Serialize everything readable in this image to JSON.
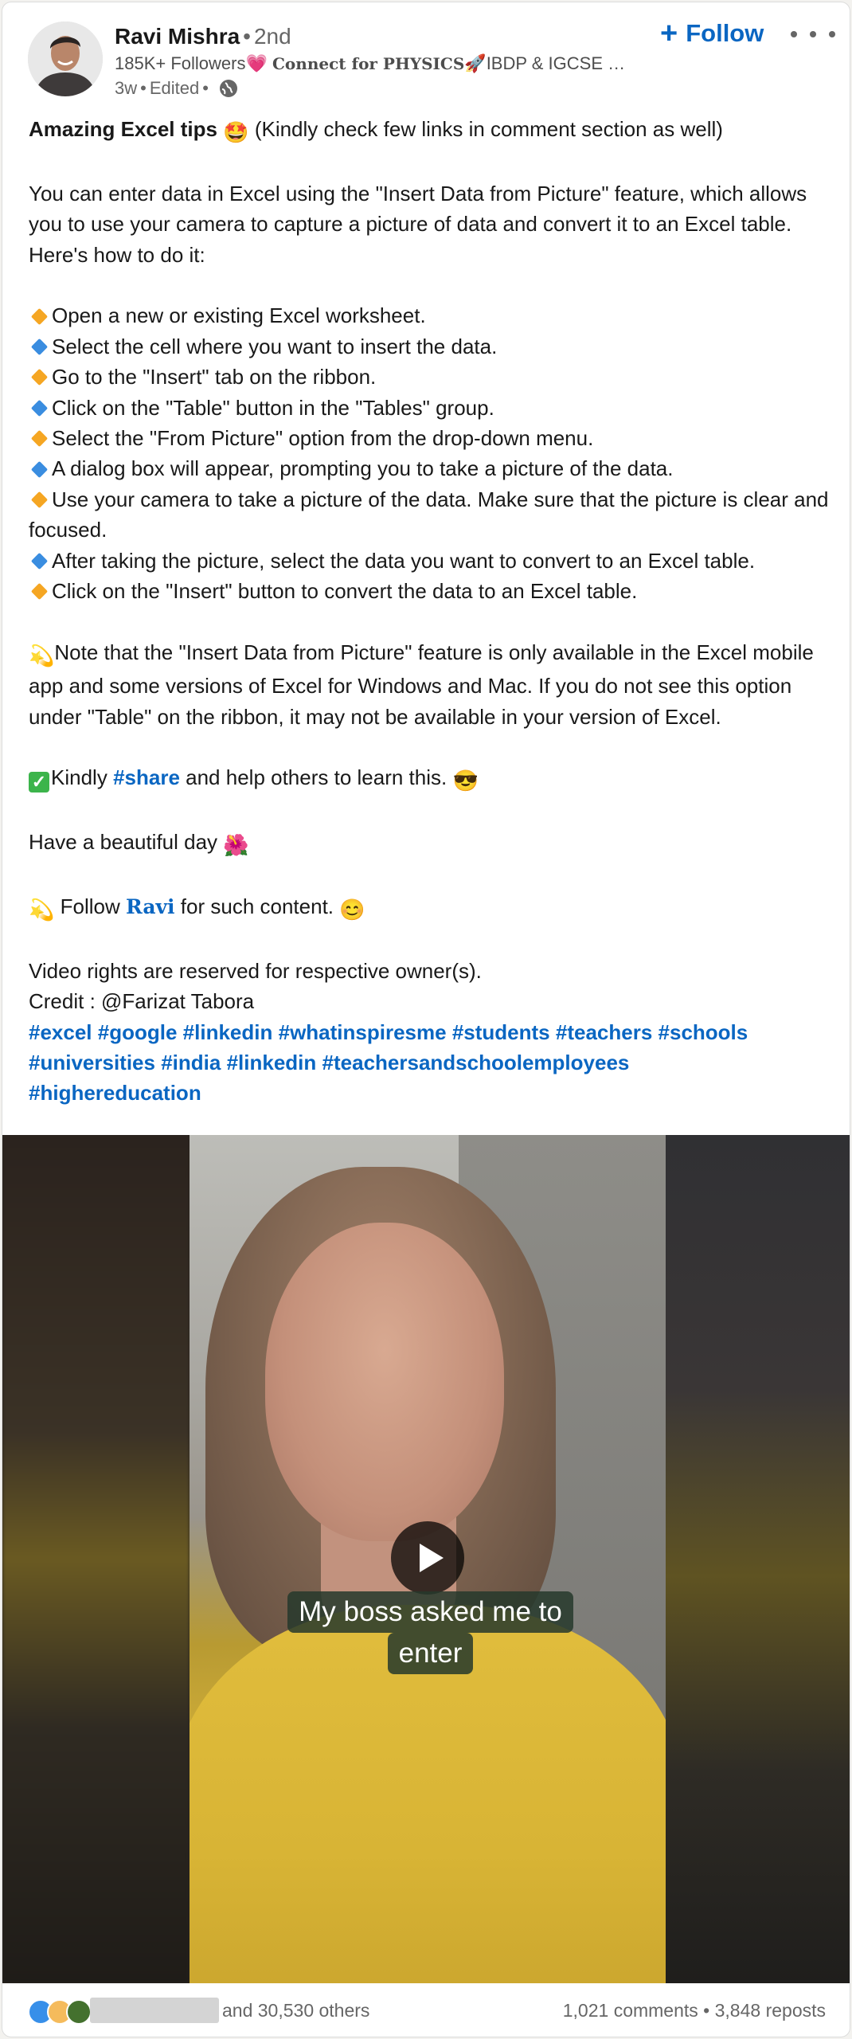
{
  "author": {
    "name": "Ravi Mishra",
    "degree": "2nd",
    "followers": "185K+ Followers",
    "headline_styled": "Connect for PHYSICS",
    "headline_rest": "IBDP & IGCSE 🌍...",
    "time": "3w",
    "edited": "Edited",
    "avatar_icon": "person-photo"
  },
  "actions": {
    "follow_label": "Follow",
    "more_icon": "ellipsis-icon"
  },
  "post": {
    "title_bold": "Amazing Excel tips",
    "title_rest": "(Kindly check few links in comment section as well)",
    "intro": "You can enter data in Excel using the \"Insert Data from Picture\" feature, which allows you to use your camera to capture a picture of data and convert it to an Excel table. Here's how to do it:",
    "steps": [
      "Open a new or existing Excel worksheet.",
      "Select the cell where you want to insert the data.",
      "Go to the \"Insert\" tab on the ribbon.",
      "Click on the \"Table\" button in the \"Tables\" group.",
      "Select the \"From Picture\" option from the drop-down menu.",
      "A dialog box will appear, prompting you to take a picture of the data.",
      "Use your camera to take a picture of the data. Make sure that the picture is clear and focused.",
      "After taking the picture, select the data you want to convert to an Excel table.",
      "Click on the \"Insert\" button to convert the data to an Excel table."
    ],
    "note": "Note that the \"Insert Data from Picture\" feature is only available in the Excel mobile app and some versions of Excel for Windows and Mac. If you do not see this option under \"Table\" on the ribbon, it may not be available in your version of Excel.",
    "share_pre": "Kindly",
    "share_tag": "#share",
    "share_post": "and help others to learn this.",
    "beautiful_day": "Have a beautiful day",
    "follow_pre": "Follow",
    "follow_name": "Ravi",
    "follow_post": "for such content.",
    "rights": "Video rights are reserved for respective owner(s).",
    "credit": "Credit : @Farizat Tabora",
    "hashtags": [
      "#excel",
      "#google",
      "#linkedin",
      "#whatinspiresme",
      "#students",
      "#teachers",
      "#schools",
      "#universities",
      "#india",
      "#linkedin",
      "#teachersandschoolemployees",
      "#highereducation"
    ]
  },
  "video": {
    "caption_line1": "My boss asked me to",
    "caption_line2": "enter",
    "play_icon": "play-icon"
  },
  "social": {
    "others": "and 30,530 others",
    "comments": "1,021 comments",
    "reposts": "3,848 reposts"
  }
}
